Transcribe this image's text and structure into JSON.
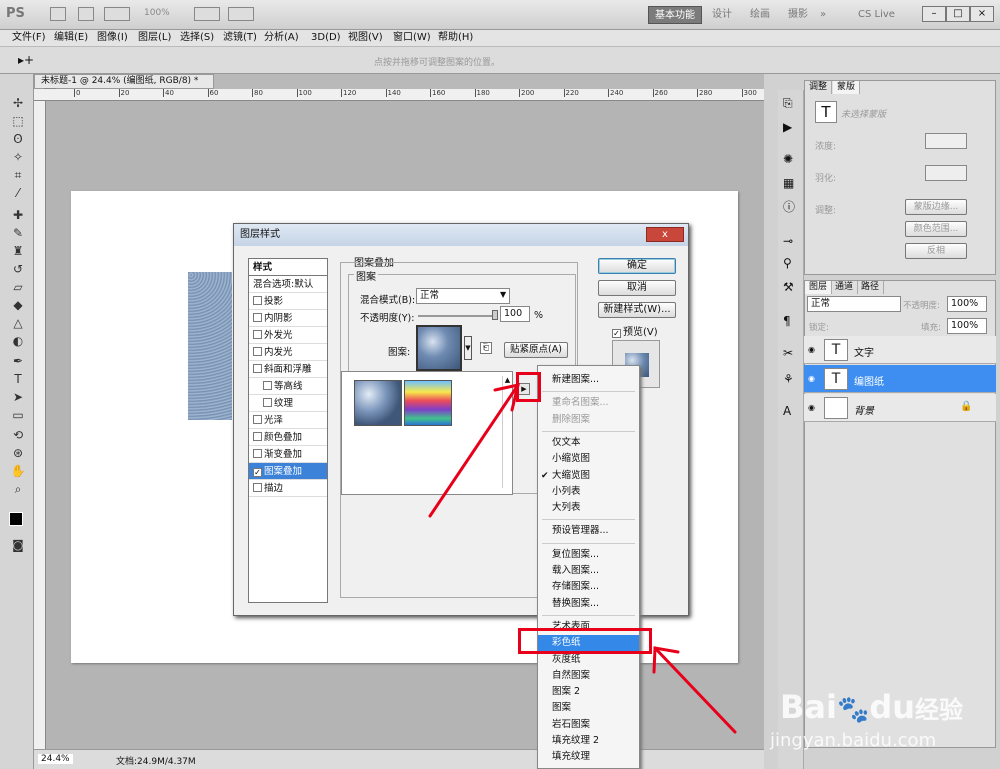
{
  "app": {
    "logo": "PS",
    "zoom_display": "100%",
    "workspaces": [
      "基本功能",
      "设计",
      "绘画",
      "摄影"
    ],
    "workspace_more": "»",
    "cslive": "CS Live"
  },
  "menubar": [
    "文件(F)",
    "编辑(E)",
    "图像(I)",
    "图层(L)",
    "选择(S)",
    "滤镜(T)",
    "分析(A)",
    "3D(D)",
    "视图(V)",
    "窗口(W)",
    "帮助(H)"
  ],
  "options_hint": "点按并拖移可调整图案的位置。",
  "document": {
    "tab_title": "未标题-1 @ 24.4% (编图纸, RGB/8) *",
    "ruler_ticks": [
      "0",
      "20",
      "40",
      "60",
      "80",
      "100",
      "120",
      "140",
      "160",
      "180",
      "200",
      "220",
      "240",
      "260",
      "280",
      "300"
    ],
    "zoom": "24.4%",
    "doc_info": "文档:24.9M/4.37M"
  },
  "adjust_panel": {
    "tabs": [
      "调整",
      "蒙版"
    ],
    "mask_label": "未选择蒙版",
    "density_label": "浓度:",
    "feather_label": "羽化:",
    "refine_label": "调整:",
    "buttons": [
      "蒙版边缘...",
      "颜色范围...",
      "反相"
    ]
  },
  "layers_panel": {
    "tabs": [
      "图层",
      "通道",
      "路径"
    ],
    "blend_mode": "正常",
    "opacity_label": "不透明度:",
    "opacity_value": "100%",
    "lock_label": "锁定:",
    "fill_label": "填充:",
    "fill_value": "100%",
    "layers": [
      {
        "name": "文字",
        "thumb": "T"
      },
      {
        "name": "编图纸",
        "thumb": "T"
      },
      {
        "name": "背景",
        "thumb": ""
      }
    ]
  },
  "dialog": {
    "title": "图层样式",
    "close": "x",
    "styles_header": "样式",
    "styles": [
      {
        "label": "混合选项:默认",
        "check": false,
        "has_box": false
      },
      {
        "label": "投影",
        "check": false,
        "has_box": true
      },
      {
        "label": "内阴影",
        "check": false,
        "has_box": true
      },
      {
        "label": "外发光",
        "check": false,
        "has_box": true
      },
      {
        "label": "内发光",
        "check": false,
        "has_box": true
      },
      {
        "label": "斜面和浮雕",
        "check": false,
        "has_box": true
      },
      {
        "label": "等高线",
        "check": false,
        "has_box": true
      },
      {
        "label": "纹理",
        "check": false,
        "has_box": true
      },
      {
        "label": "光泽",
        "check": false,
        "has_box": true
      },
      {
        "label": "颜色叠加",
        "check": false,
        "has_box": true
      },
      {
        "label": "渐变叠加",
        "check": false,
        "has_box": true
      },
      {
        "label": "图案叠加",
        "check": true,
        "has_box": true
      },
      {
        "label": "描边",
        "check": false,
        "has_box": true
      }
    ],
    "section_title": "图案叠加",
    "group_title": "图案",
    "blend_label": "混合模式(B):",
    "blend_value": "正常",
    "opacity_label": "不透明度(Y):",
    "opacity_value": "100",
    "opacity_unit": "%",
    "pattern_label": "图案:",
    "snap_button": "贴紧原点(A)",
    "ok": "确定",
    "cancel": "取消",
    "new_style": "新建样式(W)...",
    "preview": "预览(V)"
  },
  "flyout_menu": {
    "items": [
      {
        "label": "新建图案...",
        "state": "normal"
      },
      {
        "sep": true
      },
      {
        "label": "重命名图案...",
        "state": "disabled"
      },
      {
        "label": "删除图案",
        "state": "disabled"
      },
      {
        "sep": true
      },
      {
        "label": "仅文本",
        "state": "normal"
      },
      {
        "label": "小缩览图",
        "state": "normal"
      },
      {
        "label": "大缩览图",
        "state": "checked"
      },
      {
        "label": "小列表",
        "state": "normal"
      },
      {
        "label": "大列表",
        "state": "normal"
      },
      {
        "sep": true
      },
      {
        "label": "预设管理器...",
        "state": "normal"
      },
      {
        "sep": true
      },
      {
        "label": "复位图案...",
        "state": "normal"
      },
      {
        "label": "载入图案...",
        "state": "normal"
      },
      {
        "label": "存储图案...",
        "state": "normal"
      },
      {
        "label": "替换图案...",
        "state": "normal"
      },
      {
        "sep": true
      },
      {
        "label": "艺术表面",
        "state": "normal"
      },
      {
        "label": "彩色纸",
        "state": "highlighted"
      },
      {
        "label": "灰度纸",
        "state": "normal"
      },
      {
        "label": "自然图案",
        "state": "normal"
      },
      {
        "label": "图案 2",
        "state": "normal"
      },
      {
        "label": "图案",
        "state": "normal"
      },
      {
        "label": "岩石图案",
        "state": "normal"
      },
      {
        "label": "填充纹理 2",
        "state": "normal"
      },
      {
        "label": "填充纹理",
        "state": "normal"
      }
    ]
  },
  "watermark": {
    "text": "Bai",
    "logo_text": "du",
    "cn": "经验",
    "url": "jingyan.baidu.com"
  },
  "colors": {
    "accent": "#3388e8",
    "annotation": "#e8001a"
  }
}
